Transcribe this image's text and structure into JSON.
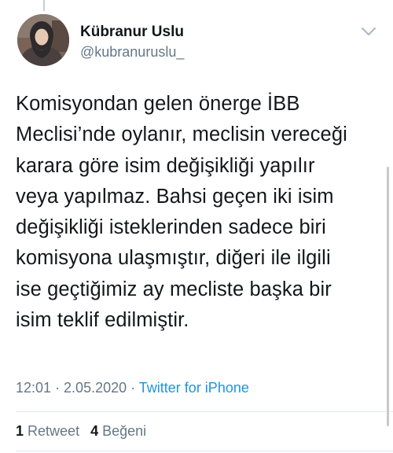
{
  "author": {
    "display_name": "Kübranur Uslu",
    "handle": "@kubranuruslu_"
  },
  "tweet": {
    "lines": [
      "Komisyondan gelen önerge İBB",
      "Meclisi’nde oylanır, meclisin vereceği",
      "karara göre isim değişikliği yapılır",
      "veya yapılmaz. Bahsi geçen iki isim",
      "değişikliği isteklerinden sadece biri",
      "komisyona ulaşmıştır, diğeri ile ilgili",
      "ise geçtiğimiz ay mecliste başka bir",
      "isim teklif edilmiştir."
    ],
    "time": "12:01",
    "separator_1": " · ",
    "date": "2.05.2020",
    "separator_2": " · ",
    "source": "Twitter for iPhone"
  },
  "stats": {
    "retweet_count": "1",
    "retweet_label": "Retweet",
    "like_count": "4",
    "like_label": "Beğeni"
  },
  "icons": {
    "menu": "chevron-down-icon"
  },
  "colors": {
    "text_primary": "#14171a",
    "text_secondary": "#657786",
    "link": "#1b95e0",
    "divider": "#e1e8ed"
  }
}
